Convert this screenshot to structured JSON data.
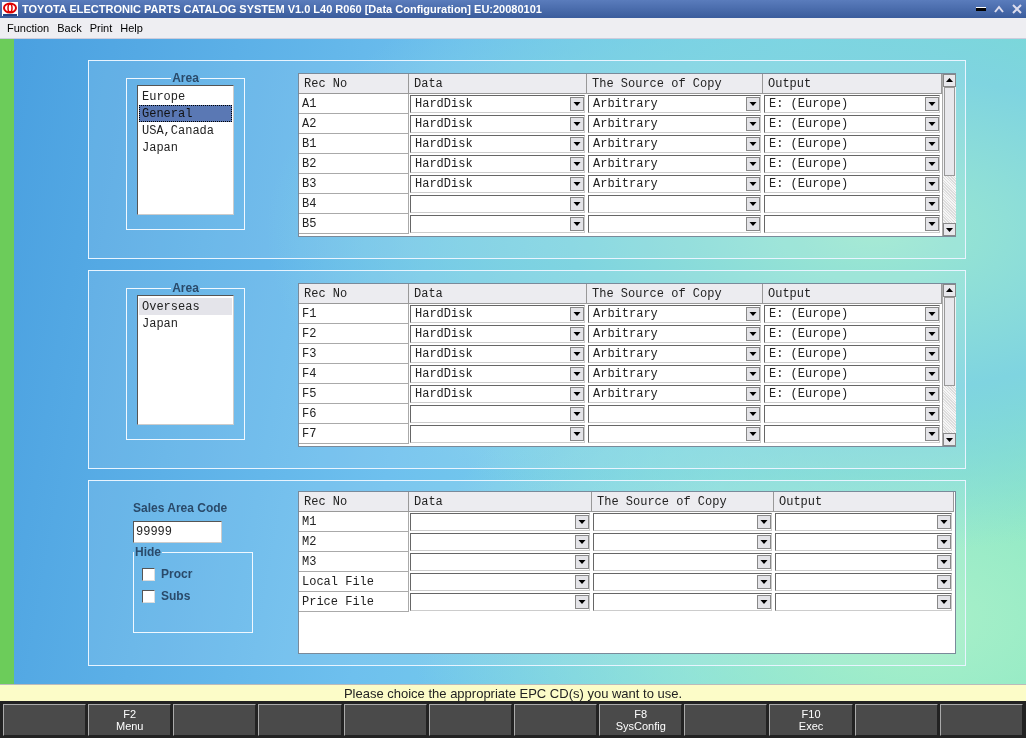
{
  "window": {
    "title": "TOYOTA ELECTRONIC PARTS CATALOG SYSTEM V1.0 L40 R060 [Data Configuration] EU:20080101"
  },
  "menu": [
    "Function",
    "Back",
    "Print",
    "Help"
  ],
  "sections": [
    {
      "kind": "area",
      "area": {
        "label": "Area",
        "focused": true,
        "items": [
          {
            "label": "Europe",
            "selected": false
          },
          {
            "label": "General",
            "selected": true
          },
          {
            "label": "USA,Canada",
            "selected": false
          },
          {
            "label": "Japan",
            "selected": false
          }
        ]
      },
      "table": {
        "scrollable": true,
        "columns": [
          "Rec No",
          "Data",
          "The Source of Copy",
          "Output"
        ],
        "rows": [
          {
            "rec_no": "A1",
            "data": "HardDisk",
            "source": "Arbitrary",
            "output": "E: (Europe)"
          },
          {
            "rec_no": "A2",
            "data": "HardDisk",
            "source": "Arbitrary",
            "output": "E: (Europe)"
          },
          {
            "rec_no": "B1",
            "data": "HardDisk",
            "source": "Arbitrary",
            "output": "E: (Europe)"
          },
          {
            "rec_no": "B2",
            "data": "HardDisk",
            "source": "Arbitrary",
            "output": "E: (Europe)"
          },
          {
            "rec_no": "B3",
            "data": "HardDisk",
            "source": "Arbitrary",
            "output": "E: (Europe)"
          },
          {
            "rec_no": "B4"
          },
          {
            "rec_no": "B5"
          }
        ]
      }
    },
    {
      "kind": "area",
      "area": {
        "label": "Area",
        "focused": false,
        "items": [
          {
            "label": "Overseas",
            "selected": true
          },
          {
            "label": "Japan",
            "selected": false
          }
        ]
      },
      "table": {
        "scrollable": true,
        "columns": [
          "Rec No",
          "Data",
          "The Source of Copy",
          "Output"
        ],
        "rows": [
          {
            "rec_no": "F1",
            "data": "HardDisk",
            "source": "Arbitrary",
            "output": "E: (Europe)"
          },
          {
            "rec_no": "F2",
            "data": "HardDisk",
            "source": "Arbitrary",
            "output": "E: (Europe)"
          },
          {
            "rec_no": "F3",
            "data": "HardDisk",
            "source": "Arbitrary",
            "output": "E: (Europe)"
          },
          {
            "rec_no": "F4",
            "data": "HardDisk",
            "source": "Arbitrary",
            "output": "E: (Europe)"
          },
          {
            "rec_no": "F5",
            "data": "HardDisk",
            "source": "Arbitrary",
            "output": "E: (Europe)"
          },
          {
            "rec_no": "F6"
          },
          {
            "rec_no": "F7"
          }
        ]
      }
    },
    {
      "kind": "sales",
      "sales_area_code": {
        "label": "Sales Area Code",
        "value": "99999"
      },
      "hide": {
        "label": "Hide",
        "options": [
          {
            "label": "Procr",
            "checked": false
          },
          {
            "label": "Subs",
            "checked": false
          }
        ]
      },
      "table": {
        "scrollable": false,
        "columns": [
          "Rec No",
          "Data",
          "The Source of Copy",
          "Output"
        ],
        "rows": [
          {
            "rec_no": "M1"
          },
          {
            "rec_no": "M2"
          },
          {
            "rec_no": "M3"
          },
          {
            "rec_no": "Local File"
          },
          {
            "rec_no": "Price File"
          }
        ]
      }
    }
  ],
  "status_message": "Please choice the appropriate EPC CD(s) you want to use.",
  "function_keys": [
    {
      "kind": "blank"
    },
    {
      "kind": "key",
      "key": "F2",
      "label": "Menu"
    },
    {
      "kind": "blank"
    },
    {
      "kind": "blank"
    },
    {
      "kind": "blank"
    },
    {
      "kind": "blank"
    },
    {
      "kind": "blank"
    },
    {
      "kind": "key",
      "key": "F8",
      "label": "SysConfig"
    },
    {
      "kind": "blank"
    },
    {
      "kind": "key",
      "key": "F10",
      "label": "Exec"
    },
    {
      "kind": "blank"
    },
    {
      "kind": "blank"
    }
  ]
}
